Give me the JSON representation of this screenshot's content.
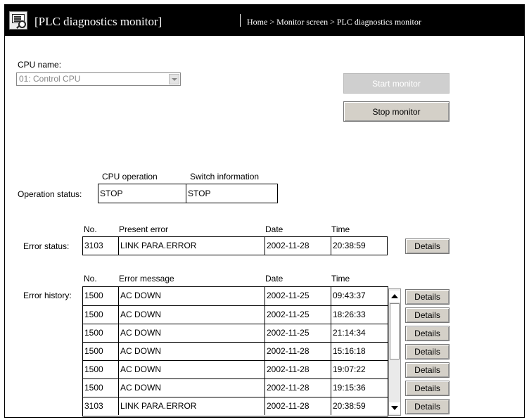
{
  "header": {
    "title": "[PLC diagnostics monitor]",
    "breadcrumb": "Home > Monitor screen > PLC diagnostics monitor"
  },
  "cpu": {
    "label": "CPU name:",
    "selected": "01: Control CPU"
  },
  "buttons": {
    "start": "Start monitor",
    "stop": "Stop monitor",
    "details": "Details"
  },
  "operation": {
    "label": "Operation status:",
    "col_cpu_operation": "CPU operation",
    "col_switch_info": "Switch information",
    "cpu_operation": "STOP",
    "switch_info": "STOP"
  },
  "error_status": {
    "label": "Error status:",
    "headers": {
      "no": "No.",
      "error": "Present error",
      "date": "Date",
      "time": "Time"
    },
    "no": "3103",
    "error": "LINK PARA.ERROR",
    "date": "2002-11-28",
    "time": "20:38:59"
  },
  "error_history": {
    "label": "Error history:",
    "headers": {
      "no": "No.",
      "message": "Error message",
      "date": "Date",
      "time": "Time"
    },
    "rows": [
      {
        "no": "1500",
        "message": "AC DOWN",
        "date": "2002-11-25",
        "time": "09:43:37"
      },
      {
        "no": "1500",
        "message": "AC DOWN",
        "date": "2002-11-25",
        "time": "18:26:33"
      },
      {
        "no": "1500",
        "message": "AC DOWN",
        "date": "2002-11-25",
        "time": "21:14:34"
      },
      {
        "no": "1500",
        "message": "AC DOWN",
        "date": "2002-11-28",
        "time": "15:16:18"
      },
      {
        "no": "1500",
        "message": "AC DOWN",
        "date": "2002-11-28",
        "time": "19:07:22"
      },
      {
        "no": "1500",
        "message": "AC DOWN",
        "date": "2002-11-28",
        "time": "19:15:36"
      },
      {
        "no": "3103",
        "message": "LINK PARA.ERROR",
        "date": "2002-11-28",
        "time": "20:38:59"
      }
    ]
  }
}
